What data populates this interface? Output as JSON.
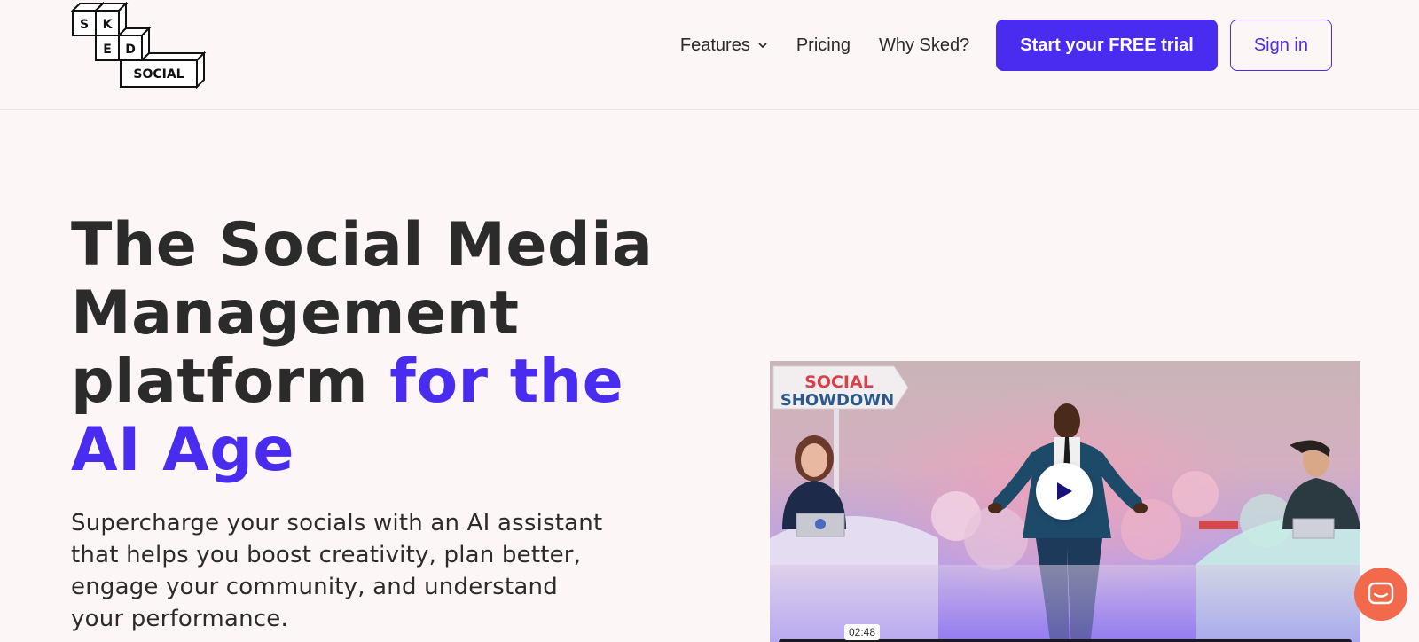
{
  "brand": {
    "logo_letters": [
      "S",
      "K",
      "E",
      "D",
      "SOCIAL"
    ],
    "primary_color": "#4a2cf0",
    "chat_color": "#f26a4b"
  },
  "nav": {
    "features_label": "Features",
    "pricing_label": "Pricing",
    "why_label": "Why Sked?",
    "trial_label": "Start your FREE trial",
    "signin_label": "Sign in"
  },
  "hero": {
    "title_part1": "The Social Media Management platform ",
    "title_accent": "for the AI Age",
    "subtitle": "Supercharge your socials with an AI assistant that helps you boost creativity, plan better, engage your community, and understand your performance."
  },
  "video": {
    "sign_line1": "SOCIAL",
    "sign_line2": "SHOWDOWN",
    "duration": "02:48"
  }
}
